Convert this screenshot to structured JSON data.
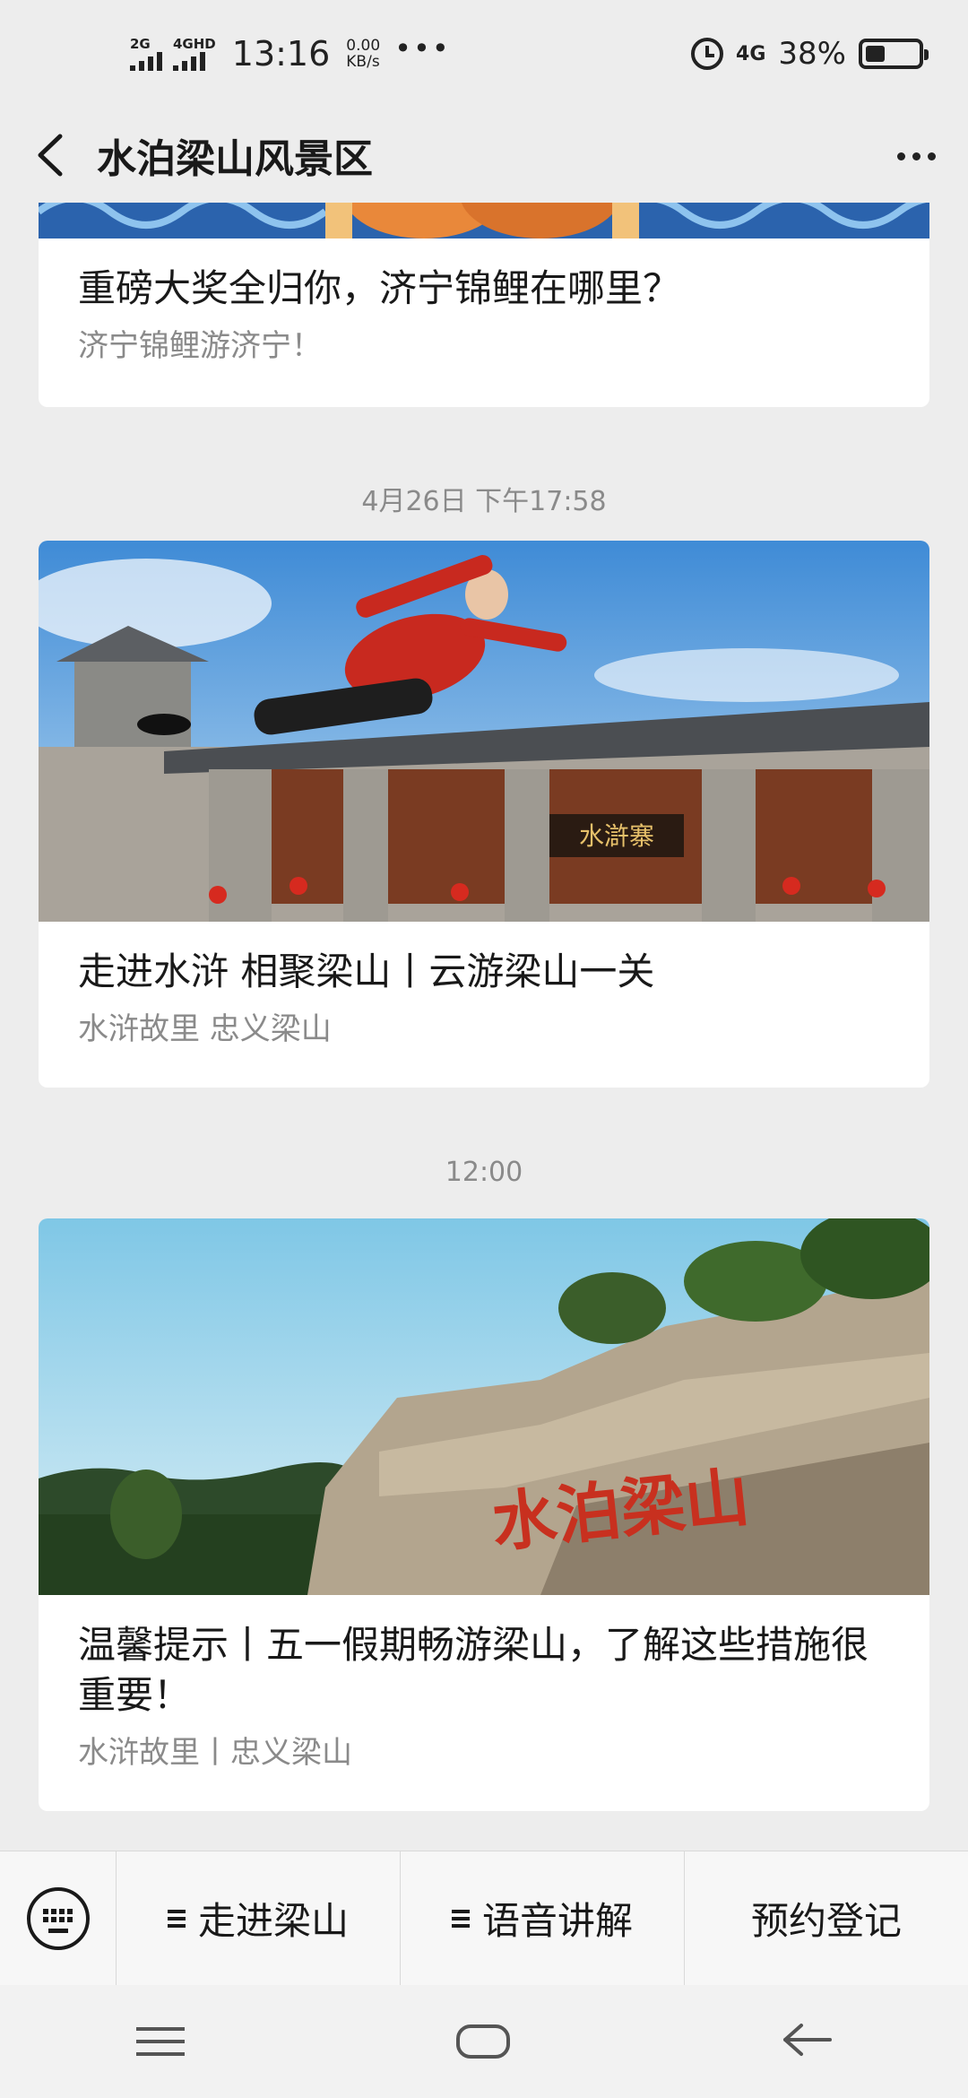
{
  "status_bar": {
    "sig1_label": "2G",
    "sig2_label": "4GHD",
    "time": "13:16",
    "speed_value": "0.00",
    "speed_unit": "KB/s",
    "more": "•••",
    "network": "4G",
    "battery": "38%",
    "battery_level": 0.38
  },
  "header": {
    "title": "水泊梁山风景区"
  },
  "feed": {
    "cards": [
      {
        "title": "重磅大奖全归你，济宁锦鲤在哪里？",
        "subtitle": "济宁锦鲤游济宁！"
      },
      {
        "timestamp": "4月26日 下午17:58",
        "title": "走进水浒 相聚梁山丨云游梁山一关",
        "subtitle": "水浒故里 忠义梁山",
        "image_text": "水滸寨"
      },
      {
        "timestamp": "12:00",
        "title": "温馨提示丨五一假期畅游梁山，了解这些措施很重要！",
        "subtitle": "水浒故里丨忠义梁山",
        "image_text": "水泊梁山"
      }
    ]
  },
  "bottom_menu": {
    "items": [
      {
        "label": "走进梁山",
        "icon": "menu-list-icon"
      },
      {
        "label": "语音讲解",
        "icon": "menu-list-icon"
      },
      {
        "label": "预约登记"
      }
    ]
  },
  "colors": {
    "background": "#ededed",
    "card": "#ffffff",
    "subtitle": "#8a8a8a",
    "title": "#191919"
  }
}
